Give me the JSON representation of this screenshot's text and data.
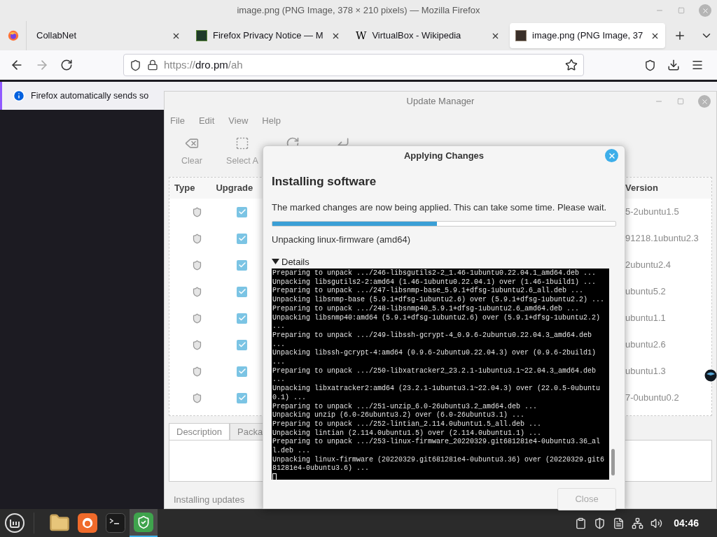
{
  "browser": {
    "title": "image.png (PNG Image, 378 × 210 pixels) — Mozilla Firefox",
    "tabs": [
      {
        "label": "CollabNet",
        "selected": false,
        "kind": "none"
      },
      {
        "label": "Firefox Privacy Notice — M",
        "selected": false,
        "kind": "square"
      },
      {
        "label": "VirtualBox - Wikipedia",
        "selected": false,
        "kind": "letter",
        "favicon": "W"
      },
      {
        "label": "image.png (PNG Image, 37",
        "selected": true,
        "kind": "image"
      }
    ],
    "url": {
      "scheme": "https://",
      "host": "dro.pm",
      "path": "/ah"
    },
    "notification": "Firefox automatically sends so"
  },
  "update_manager": {
    "title": "Update Manager",
    "menu": [
      "File",
      "Edit",
      "View",
      "Help"
    ],
    "toolbar": [
      {
        "kind": "clear",
        "label": "Clear"
      },
      {
        "kind": "select",
        "label": "Select A"
      },
      {
        "kind": "refresh"
      },
      {
        "kind": "apply"
      }
    ],
    "columns": [
      "Type",
      "Upgrade",
      "Version"
    ],
    "rows": [
      {
        "checked": true,
        "version": "5-2ubuntu1.5"
      },
      {
        "checked": true,
        "version": "91218.1ubuntu2.3"
      },
      {
        "checked": true,
        "version": "2ubuntu2.4"
      },
      {
        "checked": true,
        "version": "ubuntu5.2"
      },
      {
        "checked": true,
        "version": "ubuntu1.1"
      },
      {
        "checked": true,
        "version": "ubuntu2.6"
      },
      {
        "checked": true,
        "version": "ubuntu1.3"
      },
      {
        "checked": true,
        "version": "7-0ubuntu0.2"
      }
    ],
    "tabs": [
      {
        "label": "Description",
        "selected": true
      },
      {
        "label": "Packa",
        "selected": false
      }
    ],
    "status": "Installing updates"
  },
  "dialog": {
    "title": "Applying Changes",
    "heading": "Installing software",
    "message": "The marked changes are now being applied. This can take some time. Please wait.",
    "progress": {
      "level": 0.48
    },
    "step": "Unpacking linux-firmware (amd64)",
    "details": {
      "label": "Details",
      "expanded": true
    },
    "log": [
      "Preparing to unpack .../246-libsgutils2-2_1.46-1ubuntu0.22.04.1_amd64.deb ...",
      "Unpacking libsgutils2-2:amd64 (1.46-1ubuntu0.22.04.1) over (1.46-1build1) ...",
      "Preparing to unpack .../247-libsnmp-base_5.9.1+dfsg-1ubuntu2.6_all.deb ...",
      "Unpacking libsnmp-base (5.9.1+dfsg-1ubuntu2.6) over (5.9.1+dfsg-1ubuntu2.2) ...",
      "Preparing to unpack .../248-libsnmp40_5.9.1+dfsg-1ubuntu2.6_amd64.deb ...",
      "Unpacking libsnmp40:amd64 (5.9.1+dfsg-1ubuntu2.6) over (5.9.1+dfsg-1ubuntu2.2) ...",
      "Preparing to unpack .../249-libssh-gcrypt-4_0.9.6-2ubuntu0.22.04.3_amd64.deb ...",
      "Unpacking libssh-gcrypt-4:amd64 (0.9.6-2ubuntu0.22.04.3) over (0.9.6-2build1) ...",
      "Preparing to unpack .../250-libxatracker2_23.2.1-1ubuntu3.1~22.04.3_amd64.deb ...",
      "Unpacking libxatracker2:amd64 (23.2.1-1ubuntu3.1~22.04.3) over (22.0.5-0ubuntu0.1) ...",
      "Preparing to unpack .../251-unzip_6.0-26ubuntu3.2_amd64.deb ...",
      "Unpacking unzip (6.0-26ubuntu3.2) over (6.0-26ubuntu3.1) ...",
      "Preparing to unpack .../252-lintian_2.114.0ubuntu1.5_all.deb ...",
      "Unpacking lintian (2.114.0ubuntu1.5) over (2.114.0ubuntu1.1) ...",
      "Preparing to unpack .../253-linux-firmware_20220329.git681281e4-0ubuntu3.36_all.deb ...",
      "Unpacking linux-firmware (20220329.git681281e4-0ubuntu3.36) over (20220329.git681281e4-0ubuntu3.6) ..."
    ],
    "close_button": {
      "label": "Close",
      "disabled": true
    }
  },
  "taskbar": {
    "apps": [
      {
        "kind": "files",
        "active": false
      },
      {
        "kind": "browser",
        "active": false
      },
      {
        "kind": "terminal",
        "active": false
      },
      {
        "kind": "shield",
        "active": true
      }
    ],
    "clock": "04:46"
  }
}
